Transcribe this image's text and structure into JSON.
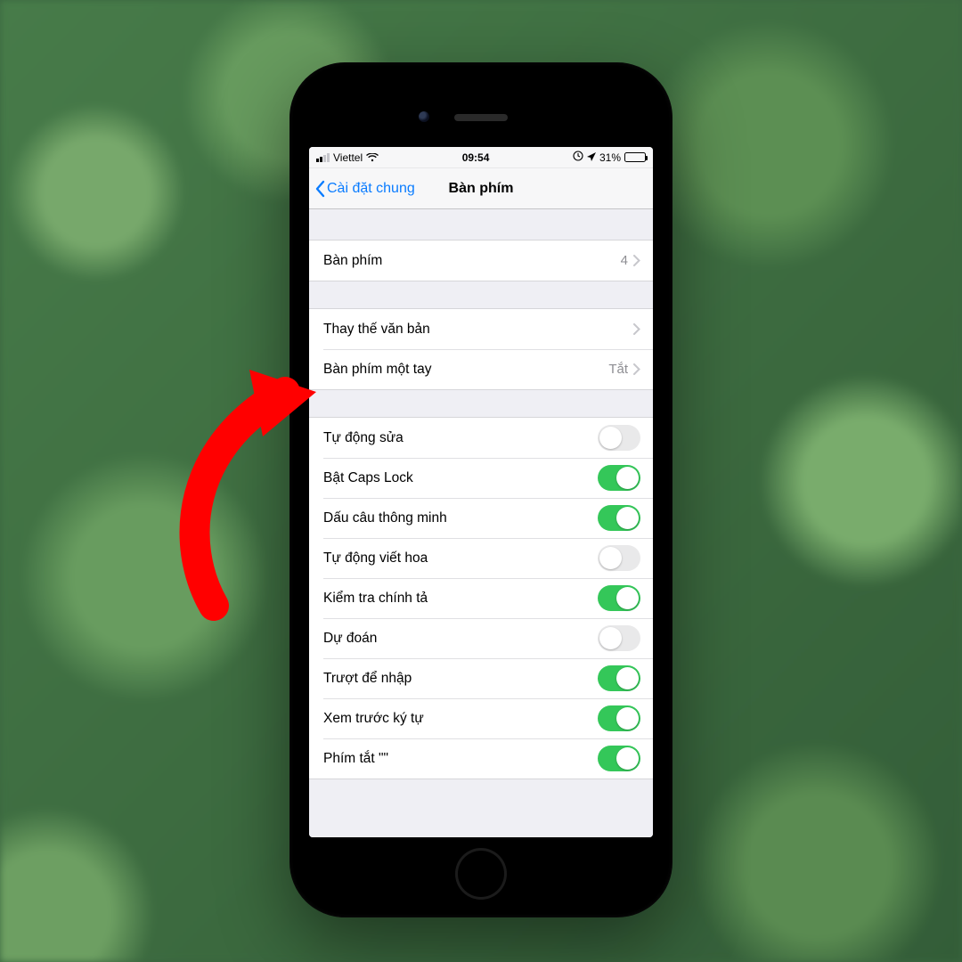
{
  "status": {
    "carrier": "Viettel",
    "time": "09:54",
    "battery_percent": "31%"
  },
  "nav": {
    "back_label": "Cài đặt chung",
    "title": "Bàn phím"
  },
  "group1": {
    "keyboards": {
      "label": "Bàn phím",
      "value": "4"
    }
  },
  "group2": {
    "text_replace": {
      "label": "Thay thế văn bản"
    },
    "one_handed": {
      "label": "Bàn phím một tay",
      "value": "Tắt"
    }
  },
  "toggles": [
    {
      "label": "Tự động sửa",
      "on": false
    },
    {
      "label": "Bật Caps Lock",
      "on": true
    },
    {
      "label": "Dấu câu thông minh",
      "on": true
    },
    {
      "label": "Tự động viết hoa",
      "on": false
    },
    {
      "label": "Kiểm tra chính tả",
      "on": true
    },
    {
      "label": "Dự đoán",
      "on": false
    },
    {
      "label": "Trượt để nhập",
      "on": true
    },
    {
      "label": "Xem trước ký tự",
      "on": true
    },
    {
      "label": "Phím tắt \"\"",
      "on": true
    }
  ]
}
